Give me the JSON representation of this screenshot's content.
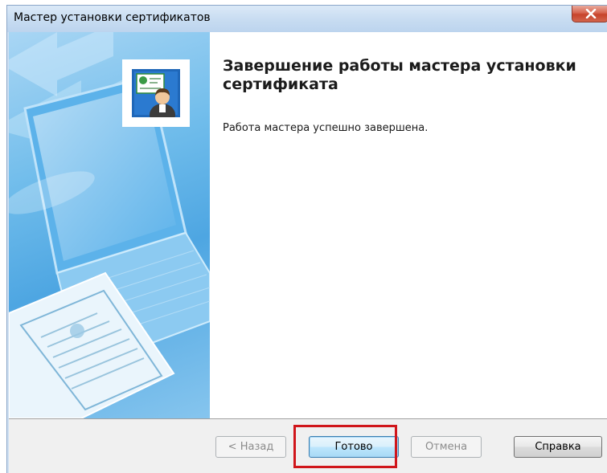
{
  "window": {
    "title": "Мастер установки сертификатов"
  },
  "wizard": {
    "icon": "certificate-user-icon",
    "heading": "Завершение работы мастера установки сертификата",
    "message": "Работа мастера успешно завершена."
  },
  "buttons": {
    "back": "< Назад",
    "finish": "Готово",
    "cancel": "Отмена",
    "help": "Справка"
  },
  "colors": {
    "titlebar": "#c7dcf1",
    "close_button": "#c7432b",
    "side_art": "#4ea6e2",
    "highlight": "#d0161b"
  }
}
